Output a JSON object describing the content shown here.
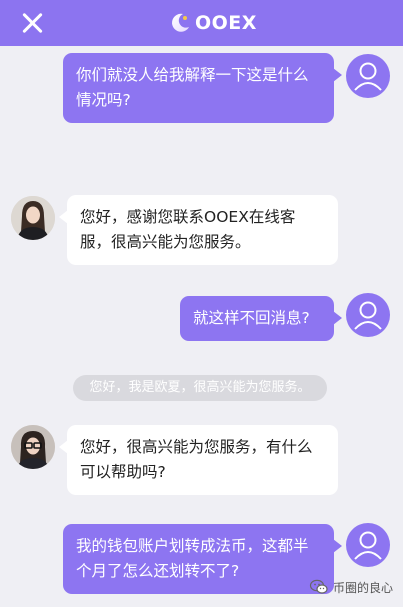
{
  "header": {
    "brand": "OOEX",
    "background": "#8c74f0"
  },
  "messages": [
    {
      "side": "right",
      "sender": "user",
      "text": "你们就没人给我解释一下这是什么情况吗?"
    },
    {
      "side": "left",
      "sender": "agent",
      "text": "您好，感谢您联系OOEX在线客服，很高兴能为您服务。"
    },
    {
      "side": "right",
      "sender": "user",
      "text": "就这样不回消息?"
    },
    {
      "side": "left",
      "sender": "agent",
      "text": "您好，很高兴能为您服务，有什么可以帮助吗?"
    },
    {
      "side": "right",
      "sender": "user",
      "text": "我的钱包账户划转成法币，这都半个月了怎么还划转不了?"
    }
  ],
  "system_notice": "您好，我是欧夏，很高兴能为您服务。",
  "watermark": {
    "text": "币圈的良心",
    "icon": "wechat-icon"
  },
  "colors": {
    "accent": "#8d75f1",
    "page_bg": "#efeff4",
    "agent_bubble": "#ffffff"
  },
  "icons": {
    "close": "close-icon",
    "logo": "ooex-logo-icon",
    "user_avatar": "user-avatar-icon",
    "agent_avatar": "agent-avatar-photo"
  }
}
